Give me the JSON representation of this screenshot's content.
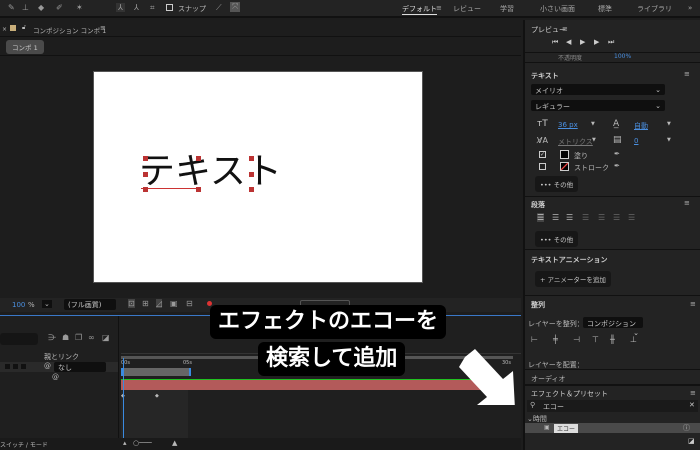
{
  "toolbar": {
    "snap_label": "スナップ",
    "workspaces": [
      "デフォルト",
      "レビュー",
      "学習",
      "小さい画面",
      "標準",
      "ライブラリ"
    ],
    "more": "»"
  },
  "comp": {
    "panel_title": "コンポジション コンポ 1",
    "tab": "コンポ 1",
    "canvas_text": "テキスト",
    "zoom": "100",
    "zoom_unit": "%",
    "quality": "(フル画質)"
  },
  "timeline": {
    "column_parent": "親とリンク",
    "parent_value": "なし",
    "ruler": [
      "00s",
      "05s",
      "30s"
    ],
    "footer": "スイッチ / モード"
  },
  "preview": {
    "title": "プレビュー",
    "opacity_label": "不透明度",
    "opacity_value": "100%"
  },
  "text_panel": {
    "title": "テキスト",
    "font": "メイリオ",
    "style": "レギュラー",
    "size": "36 px",
    "leading": "自動",
    "kerning": "メトリクス",
    "tracking": "0",
    "fill_label": "塗り",
    "stroke_label": "ストローク",
    "more": "••• その他"
  },
  "paragraph": {
    "title": "段落",
    "more": "••• その他"
  },
  "text_animation": {
    "title": "テキストアニメーション",
    "add_animator": "+ アニメーターを追加"
  },
  "align": {
    "title": "整列",
    "align_to_label": "レイヤーを整列：",
    "align_to_value": "コンポジション",
    "distribute_label": "レイヤーを配置："
  },
  "audio": {
    "title": "オーディオ"
  },
  "effects": {
    "title": "エフェクト＆プリセット",
    "search_value": "エコー",
    "category": "時間",
    "result": "エコー"
  },
  "callout": {
    "line1": "エフェクトのエコーを",
    "line2": "検索して追加"
  },
  "colors": {
    "accent": "#4a8fe0",
    "layer_bar": "#b35a5a",
    "green": "#20c020"
  }
}
